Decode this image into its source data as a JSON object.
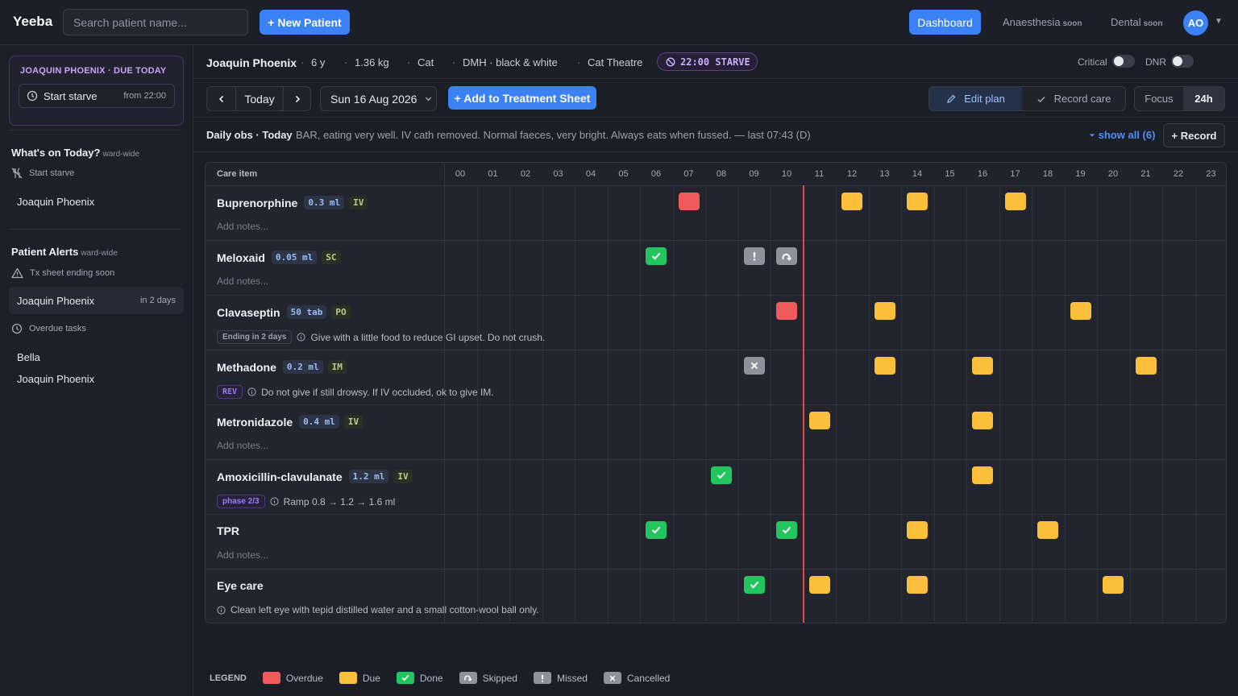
{
  "app": {
    "brand": "Yeeba"
  },
  "topnav": {
    "search_placeholder": "Search patient name...",
    "new_patient": "+ New Patient",
    "dashboard": "Dashboard",
    "anaesthesia": "Anaesthesia",
    "dental": "Dental",
    "soon": "soon",
    "avatar": "AO"
  },
  "sidebar": {
    "due_title": "JOAQUIN PHOENIX · DUE TODAY",
    "due_task": "Start starve",
    "due_from": "from 22:00",
    "whats_on": "What's on Today?",
    "ward_wide": "ward-wide",
    "start_starve": "Start starve",
    "whats_on_patient": "Joaquin Phoenix",
    "alerts_title": "Patient Alerts",
    "tx_ending": "Tx sheet ending soon",
    "alert_patient": "Joaquin Phoenix",
    "alert_days": "in 2 days",
    "overdue": "Overdue tasks",
    "overdue_patients": [
      "Bella",
      "Joaquin Phoenix"
    ]
  },
  "patient": {
    "name": "Joaquin Phoenix",
    "age": "6 y",
    "weight": "1.36 kg",
    "species": "Cat",
    "breed": "DMH · black & white",
    "location": "Cat Theatre",
    "starve": "22:00 STARVE",
    "critical": "Critical",
    "dnr": "DNR",
    "critical_on": false,
    "dnr_on": false
  },
  "toolbar": {
    "today": "Today",
    "date": "Sun 16 Aug 2026",
    "add_treatment": "+ Add to Treatment Sheet",
    "edit_plan": "Edit plan",
    "record_care": "Record care",
    "focus": "Focus",
    "h24": "24h"
  },
  "obs": {
    "title": "Daily obs · Today",
    "text": "BAR, eating very well. IV cath removed. Normal faeces, very bright. Always eats when fussed. — last 07:43 (D)",
    "show_all": "show all (6)",
    "record": "+ Record"
  },
  "grid": {
    "care_item_header": "Care item",
    "hours": [
      "00",
      "01",
      "02",
      "03",
      "04",
      "05",
      "06",
      "07",
      "08",
      "09",
      "10",
      "11",
      "12",
      "13",
      "14",
      "15",
      "16",
      "17",
      "18",
      "19",
      "20",
      "21",
      "22",
      "23"
    ],
    "add_notes": "Add notes...",
    "rows": [
      {
        "name": "Buprenorphine",
        "dose": "0.3 ml",
        "route": "IV",
        "note_tag": "",
        "note": "",
        "cells": [
          [
            7,
            "overdue"
          ],
          [
            12,
            "due"
          ],
          [
            14,
            "due"
          ],
          [
            17,
            "due"
          ]
        ]
      },
      {
        "name": "Meloxaid",
        "dose": "0.05 ml",
        "route": "SC",
        "note_tag": "",
        "note": "",
        "cells": [
          [
            6,
            "done"
          ],
          [
            9,
            "missed"
          ],
          [
            10,
            "skipped"
          ]
        ]
      },
      {
        "name": "Clavaseptin",
        "dose": "50 tab",
        "route": "PO",
        "note_tag": "Ending in 2 days",
        "note": "Give with a little food to reduce GI upset. Do not crush.",
        "cells": [
          [
            10,
            "overdue"
          ],
          [
            13,
            "due"
          ],
          [
            19,
            "due"
          ]
        ]
      },
      {
        "name": "Methadone",
        "dose": "0.2 ml",
        "route": "IM",
        "note_tag": "REV",
        "note": "Do not give if still drowsy. If IV occluded, ok to give IM.",
        "cells": [
          [
            9,
            "cancelled"
          ],
          [
            13,
            "due"
          ],
          [
            16,
            "due"
          ],
          [
            21,
            "due"
          ]
        ]
      },
      {
        "name": "Metronidazole",
        "dose": "0.4 ml",
        "route": "IV",
        "note_tag": "",
        "note": "",
        "cells": [
          [
            11,
            "due"
          ],
          [
            16,
            "due"
          ]
        ]
      },
      {
        "name": "Amoxicillin-clavulanate",
        "dose": "1.2 ml",
        "route": "IV",
        "note_tag": "phase 2/3",
        "note": "Ramp 0.8 → 1.2 → 1.6 ml",
        "cells": [
          [
            8,
            "done"
          ],
          [
            16,
            "due"
          ]
        ]
      },
      {
        "name": "TPR",
        "dose": "",
        "route": "",
        "note_tag": "",
        "note": "",
        "cells": [
          [
            6,
            "done"
          ],
          [
            10,
            "done"
          ],
          [
            14,
            "due"
          ],
          [
            18,
            "due"
          ]
        ]
      },
      {
        "name": "Eye care",
        "dose": "",
        "route": "",
        "note_tag": "",
        "note": "Clean left eye with tepid distilled water and a small cotton-wool ball only.",
        "cells": [
          [
            9,
            "done"
          ],
          [
            11,
            "due"
          ],
          [
            14,
            "due"
          ],
          [
            20,
            "due"
          ]
        ]
      }
    ]
  },
  "legend": {
    "title": "LEGEND",
    "overdue": "Overdue",
    "due": "Due",
    "done": "Done",
    "skipped": "Skipped",
    "missed": "Missed",
    "cancelled": "Cancelled"
  },
  "colors": {
    "accent": "#3b82f6",
    "overdue": "#f05a5a",
    "due": "#fbbf3c",
    "done": "#22c55e",
    "neutral": "#8e929c"
  }
}
